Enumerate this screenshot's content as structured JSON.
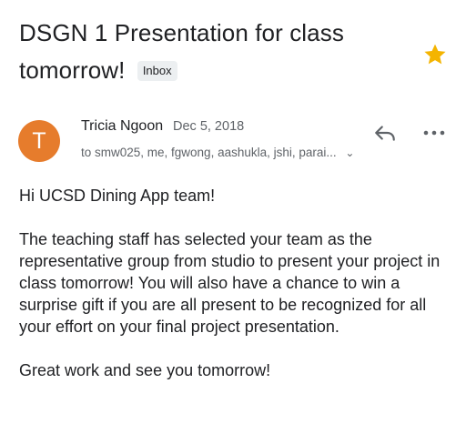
{
  "message": {
    "subject": "DSGN 1 Presentation for class tomorrow!",
    "label": "Inbox",
    "starred": true,
    "accent_color": "#f4b400"
  },
  "sender": {
    "avatar_letter": "T",
    "avatar_color": "#e67c2c",
    "name": "Tricia Ngoon",
    "date": "Dec 5, 2018",
    "recipients": "to smw025, me, fgwong, aashukla, jshi, parai...",
    "recipients_toggle_icon": "chevron-down-icon"
  },
  "actions": {
    "reply_icon": "reply-icon",
    "more_icon": "more-horizontal-icon"
  },
  "body": {
    "greeting": "Hi UCSD Dining App team!",
    "paragraph": "The teaching staff has selected your team as the representative group from studio to present your project in class tomorrow! You will also have a chance to win a surprise gift if you are all present to be recognized for all your effort on your final project presentation.",
    "closing": "Great work and see you tomorrow!"
  }
}
